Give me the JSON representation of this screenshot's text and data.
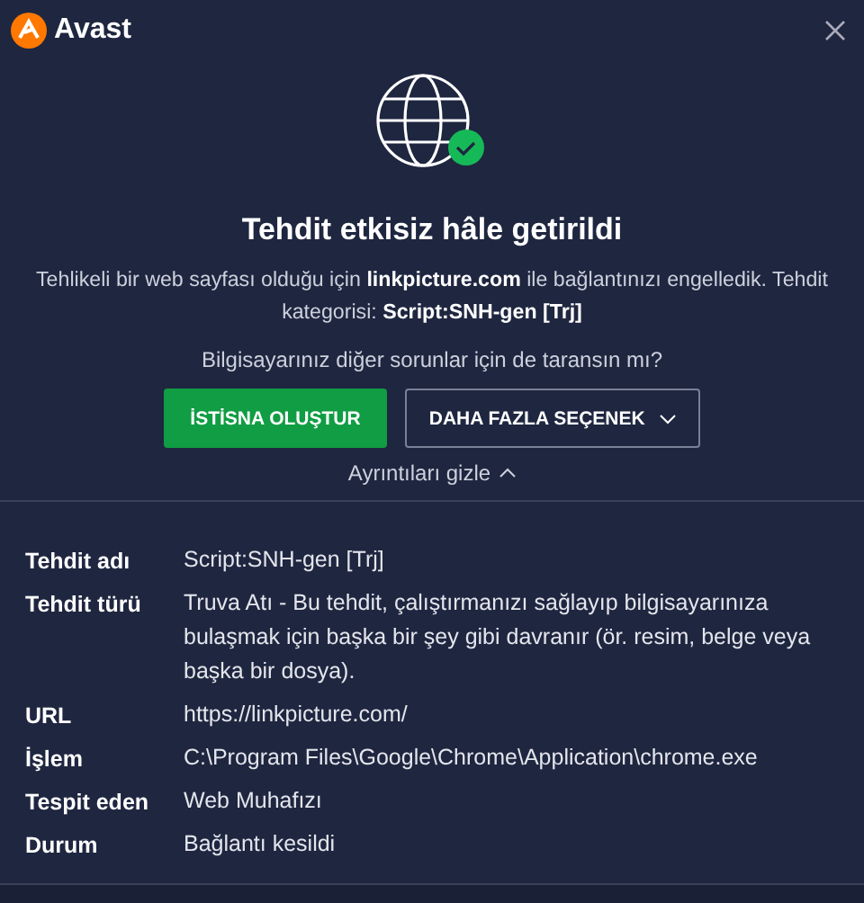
{
  "window": {
    "app_name": "Avast"
  },
  "title": "Tehdit etkisiz hâle getirildi",
  "description": "Tehlikeli bir web sayfası olduğu için **linkpicture.com** ile bağlantınızı engelledik. Tehdit kategorisi: **Script:SNH-gen [Trj]**",
  "question": "Bilgisayarınız diğer sorunlar için de taransın mı?",
  "buttons": [
    {
      "label": "İSTİSNA OLUŞTUR",
      "kind": "primary"
    },
    {
      "label": "DAHA FAZLA SEÇENEK",
      "kind": "dropdown"
    }
  ],
  "details_toggle": {
    "label": "Ayrıntıları gizle",
    "expanded": true
  },
  "details": [
    {
      "label": "Tehdit adı",
      "value": "Script:SNH-gen [Trj]"
    },
    {
      "label": "Tehdit türü",
      "value": "Truva Atı - Bu tehdit, çalıştırmanızı sağlayıp bilgisayarınıza bulaşmak için başka bir şey gibi davranır (ör. resim, belge veya başka bir dosya)."
    },
    {
      "label": "URL",
      "value": "https://linkpicture.com/"
    },
    {
      "label": "İşlem",
      "value": "C:\\Program Files\\Google\\Chrome\\Application\\chrome.exe"
    },
    {
      "label": "Tespit eden",
      "value": "Web Muhafızı"
    },
    {
      "label": "Durum",
      "value": "Bağlantı kesildi"
    }
  ]
}
